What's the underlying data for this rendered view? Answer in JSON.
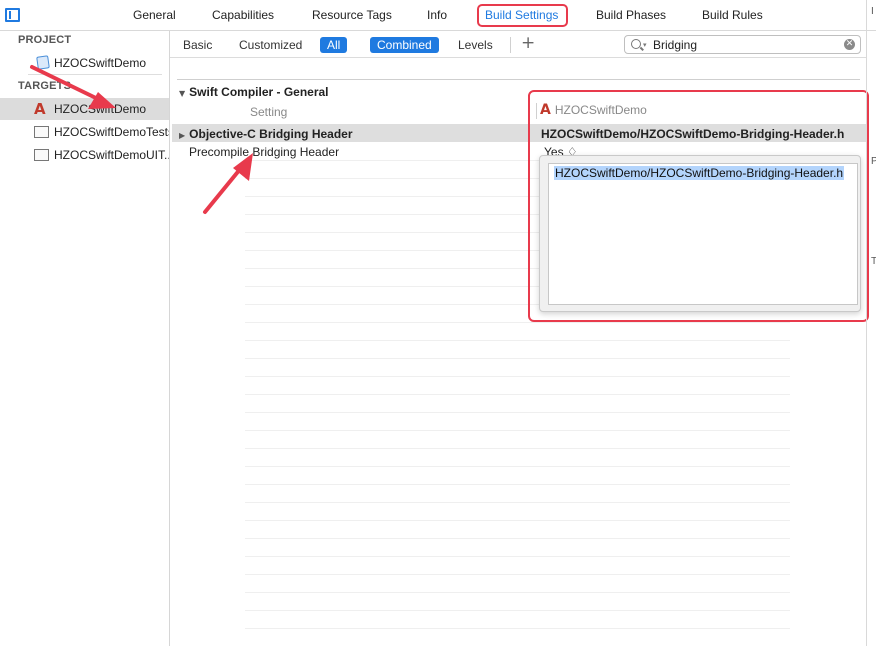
{
  "top_tabs": {
    "general": "General",
    "capabilities": "Capabilities",
    "resource_tags": "Resource Tags",
    "info": "Info",
    "build_settings": "Build Settings",
    "build_phases": "Build Phases",
    "build_rules": "Build Rules"
  },
  "navigator": {
    "project_heading": "PROJECT",
    "project_item": "HZOCSwiftDemo",
    "targets_heading": "TARGETS",
    "targets": [
      "HZOCSwiftDemo",
      "HZOCSwiftDemoTests",
      "HZOCSwiftDemoUIT..."
    ]
  },
  "filter": {
    "basic": "Basic",
    "customized": "Customized",
    "all": "All",
    "combined": "Combined",
    "levels": "Levels",
    "add": "+",
    "search_value": "Bridging"
  },
  "settings": {
    "section_title": "Swift Compiler - General",
    "col_setting": "Setting",
    "col_target": "HZOCSwiftDemo",
    "rows": [
      {
        "name": "Objective-C Bridging Header",
        "value": "HZOCSwiftDemo/HZOCSwiftDemo-Bridging-Header.h"
      },
      {
        "name": "Precompile Bridging Header",
        "value": "Yes ♢"
      }
    ],
    "editor_value": "HZOCSwiftDemo/HZOCSwiftDemo-Bridging-Header.h"
  },
  "edge_marks": [
    "I",
    "P",
    "T"
  ],
  "colors": {
    "accent": "#1f7ae0",
    "annotation": "#e83a4c",
    "selection": "#b3d4fc"
  }
}
